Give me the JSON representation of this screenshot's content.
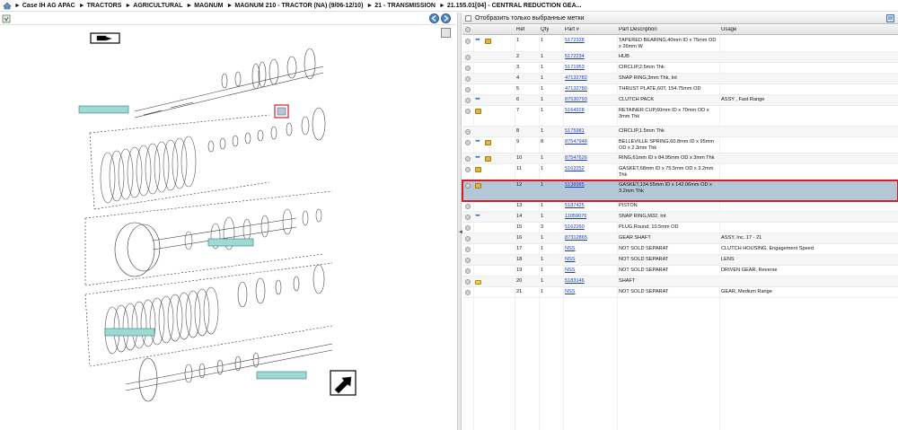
{
  "breadcrumb": [
    "Case IH AG APAC",
    "TRACTORS",
    "AGRICULTURAL",
    "MAGNUM",
    "MAGNUM 210 - TRACTOR (NA) (9/06-12/10)",
    "21 - TRANSMISSION",
    "21.155.01[04] - CENTRAL REDUCTION GEA..."
  ],
  "filter_label": "Отобразить только выбранные метки",
  "columns": {
    "ref": "Ref",
    "qty": "Qty",
    "part": "Part #",
    "desc": "Part Description",
    "usage": "Usage"
  },
  "rows": [
    {
      "ref": "1",
      "qty": "1",
      "part": "5172328",
      "desc": "TAPERED BEARING,40mm ID x 75mm OD x 26mm W",
      "usage": "",
      "icons": [
        "grey",
        "blue",
        "box"
      ]
    },
    {
      "ref": "2",
      "qty": "1",
      "part": "5172234",
      "desc": "HUB",
      "usage": "",
      "icons": [
        "grey"
      ]
    },
    {
      "ref": "3",
      "qty": "1",
      "part": "5171953",
      "desc": "CIRCLIP,2.5mm Thk",
      "usage": "",
      "icons": [
        "grey"
      ]
    },
    {
      "ref": "4",
      "qty": "1",
      "part": "47132782",
      "desc": "SNAP RING,3mm Thk, Int",
      "usage": "",
      "icons": [
        "grey"
      ]
    },
    {
      "ref": "5",
      "qty": "1",
      "part": "47132780",
      "desc": "THRUST PLATE,60T, 154.75mm OD",
      "usage": "",
      "icons": [
        "grey"
      ]
    },
    {
      "ref": "6",
      "qty": "1",
      "part": "87530793",
      "desc": "CLUTCH PACK",
      "usage": "ASSY , Fast Range",
      "icons": [
        "grey",
        "blue"
      ]
    },
    {
      "ref": "7",
      "qty": "1",
      "part": "5164928",
      "desc": "RETAINER CUP,60mm ID x 70mm OD x 3mm Thk",
      "usage": "",
      "icons": [
        "grey",
        "box"
      ]
    },
    {
      "ref": "8",
      "qty": "1",
      "part": "5175981",
      "desc": "CIRCLIP,1.5mm Thk",
      "usage": "",
      "icons": [
        "grey"
      ]
    },
    {
      "ref": "9",
      "qty": "8",
      "part": "87547948",
      "desc": "BELLEVILLE SPRING,60.8mm ID x 95mm OD x 2.3mm Thk",
      "usage": "",
      "icons": [
        "grey",
        "blue",
        "box"
      ]
    },
    {
      "ref": "10",
      "qty": "1",
      "part": "87547626",
      "desc": "RING,61mm ID x 84.95mm OD x 3mm Thk",
      "usage": "",
      "icons": [
        "grey",
        "blue",
        "box"
      ]
    },
    {
      "ref": "11",
      "qty": "1",
      "part": "5162252",
      "desc": "GASKET,68mm ID x 75.5mm OD x 3.2mm Thk",
      "usage": "",
      "icons": [
        "grey",
        "box"
      ]
    },
    {
      "ref": "12",
      "qty": "1",
      "part": "5138985",
      "desc": "GASKET,134.55mm ID x 142.06mm OD x 3.2mm Thk",
      "usage": "",
      "icons": [
        "grey",
        "box"
      ],
      "selected": true
    },
    {
      "ref": "13",
      "qty": "1",
      "part": "5187425",
      "desc": "PISTON",
      "usage": "",
      "icons": [
        "grey"
      ]
    },
    {
      "ref": "14",
      "qty": "1",
      "part": "11059076",
      "desc": "SNAP RING,M32, Int",
      "usage": "",
      "icons": [
        "grey",
        "blue"
      ]
    },
    {
      "ref": "15",
      "qty": "3",
      "part": "5162260",
      "desc": "PLUG,Round, 10.5mm OD",
      "usage": "",
      "icons": [
        "grey"
      ]
    },
    {
      "ref": "16",
      "qty": "1",
      "part": "87312865",
      "desc": "GEAR SHAFT",
      "usage": "ASSY, Inc. 17 - 21",
      "icons": [
        "grey"
      ]
    },
    {
      "ref": "17",
      "qty": "1",
      "part": "NSS",
      "desc": "NOT SOLD SEPARAT",
      "usage": "CLUTCH HOUSING, Engagement Speed",
      "icons": [
        "grey"
      ]
    },
    {
      "ref": "18",
      "qty": "1",
      "part": "NSS",
      "desc": "NOT SOLD SEPARAT",
      "usage": "LENS",
      "icons": [
        "grey"
      ]
    },
    {
      "ref": "19",
      "qty": "1",
      "part": "NSS",
      "desc": "NOT SOLD SEPARAT",
      "usage": "DRIVEN GEAR, Reverse",
      "icons": [
        "grey"
      ]
    },
    {
      "ref": "20",
      "qty": "1",
      "part": "5183146",
      "desc": "SHAFT",
      "usage": "",
      "icons": [
        "grey",
        "fold"
      ]
    },
    {
      "ref": "21",
      "qty": "1",
      "part": "NSS",
      "desc": "NOT SOLD SEPARAT",
      "usage": "GEAR, Medium Range",
      "icons": [
        "grey"
      ]
    }
  ],
  "colors": {
    "selected_row": "#b4c7d6",
    "selected_outline": "#d21e2b",
    "link": "#1a3cc9"
  }
}
